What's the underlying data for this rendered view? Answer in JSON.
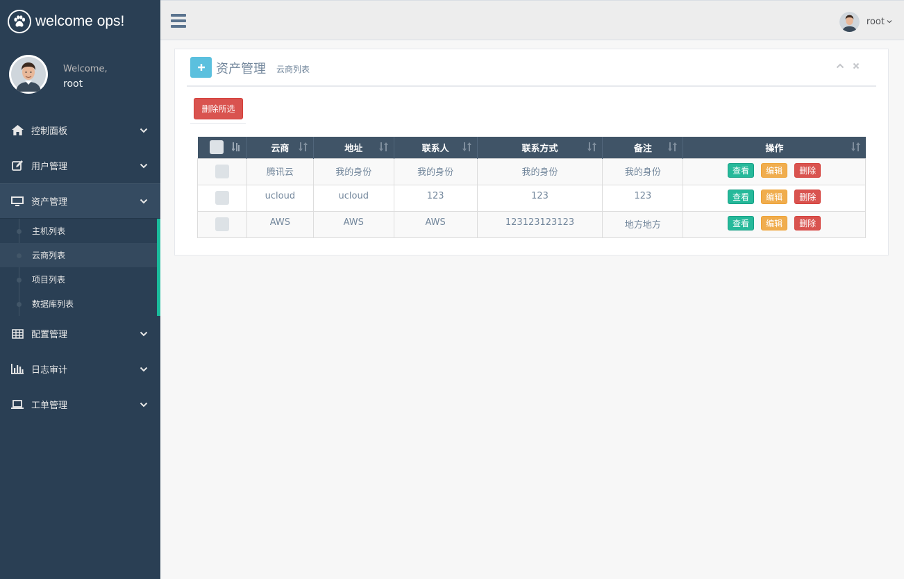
{
  "brand": {
    "title": "welcome ops!",
    "icon": "paw-icon"
  },
  "profile": {
    "welcome": "Welcome,",
    "username": "root"
  },
  "menu": [
    {
      "label": "控制面板",
      "icon": "home-icon"
    },
    {
      "label": "用户管理",
      "icon": "edit-icon"
    },
    {
      "label": "资产管理",
      "icon": "desktop-icon",
      "submenu": [
        "主机列表",
        "云商列表",
        "项目列表",
        "数据库列表"
      ],
      "current": "云商列表"
    },
    {
      "label": "配置管理",
      "icon": "table-icon"
    },
    {
      "label": "日志审计",
      "icon": "bar-chart-icon"
    },
    {
      "label": "工单管理",
      "icon": "laptop-icon"
    }
  ],
  "topnav": {
    "username": "root"
  },
  "panel": {
    "title": "资产管理",
    "subtitle": "云商列表",
    "delete_selected": "删除所选"
  },
  "table": {
    "headers": [
      "云商",
      "地址",
      "联系人",
      "联系方式",
      "备注",
      "操作"
    ],
    "rows": [
      [
        "腾讯云",
        "我的身份",
        "我的身份",
        "我的身份",
        "我的身份"
      ],
      [
        "ucloud",
        "ucloud",
        "123",
        "123",
        "123"
      ],
      [
        "AWS",
        "AWS",
        "AWS",
        "123123123123",
        "地方地方"
      ]
    ],
    "actions": {
      "view": "查看",
      "edit": "编辑",
      "delete": "删除"
    }
  },
  "colors": {
    "sidebar": "#2a3f54",
    "accent": "#1abb9c",
    "header": "#405467",
    "danger": "#d9534f",
    "warning": "#f0ad4e",
    "success": "#26b99a",
    "info": "#5bc0de"
  }
}
